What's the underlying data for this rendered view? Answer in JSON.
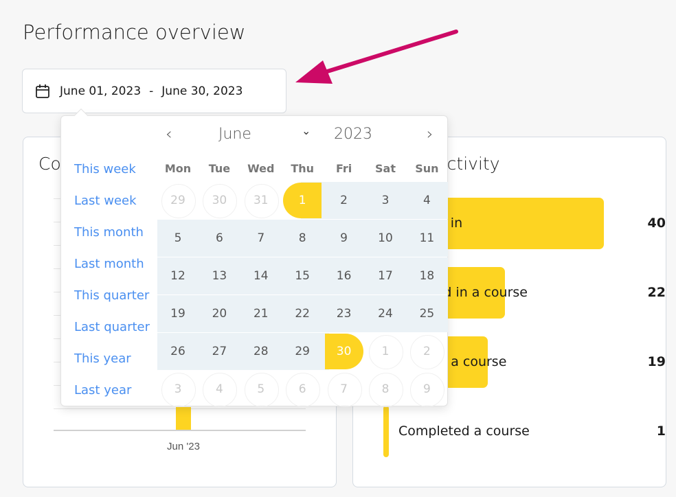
{
  "page": {
    "title": "Performance overview"
  },
  "date_range": {
    "start": "June 01, 2023",
    "separator": "-",
    "end": "June 30, 2023",
    "icon": "calendar-icon"
  },
  "left_card": {
    "title": "Co",
    "chart_data": {
      "type": "bar",
      "categories": [
        "Jun '23"
      ],
      "values": [
        1
      ],
      "grid": true
    }
  },
  "right_card": {
    "title": "Activity",
    "rows": [
      {
        "label": "Logged in",
        "value": 40
      },
      {
        "label": "Enrolled in a course",
        "value": 22
      },
      {
        "label": "Started a course",
        "value": 19
      },
      {
        "label": "Completed a course",
        "value": 1
      }
    ]
  },
  "calendar": {
    "month": "June",
    "year": "2023",
    "presets": [
      "This week",
      "Last week",
      "This month",
      "Last month",
      "This quarter",
      "Last quarter",
      "This year",
      "Last year"
    ],
    "weekdays": [
      "Mon",
      "Tue",
      "Wed",
      "Thu",
      "Fri",
      "Sat",
      "Sun"
    ],
    "weeks": [
      [
        "29",
        "30",
        "31",
        "1",
        "2",
        "3",
        "4"
      ],
      [
        "5",
        "6",
        "7",
        "8",
        "9",
        "10",
        "11"
      ],
      [
        "12",
        "13",
        "14",
        "15",
        "16",
        "17",
        "18"
      ],
      [
        "19",
        "20",
        "21",
        "22",
        "23",
        "24",
        "25"
      ],
      [
        "26",
        "27",
        "28",
        "29",
        "30",
        "1",
        "2"
      ],
      [
        "3",
        "4",
        "5",
        "6",
        "7",
        "8",
        "9"
      ]
    ],
    "range_start": "1",
    "range_end": "30"
  },
  "colors": {
    "accent": "#fdd422",
    "link": "#4a8ff0",
    "range": "#ebf2f6",
    "annotation_arrow": "#cc0a66"
  }
}
